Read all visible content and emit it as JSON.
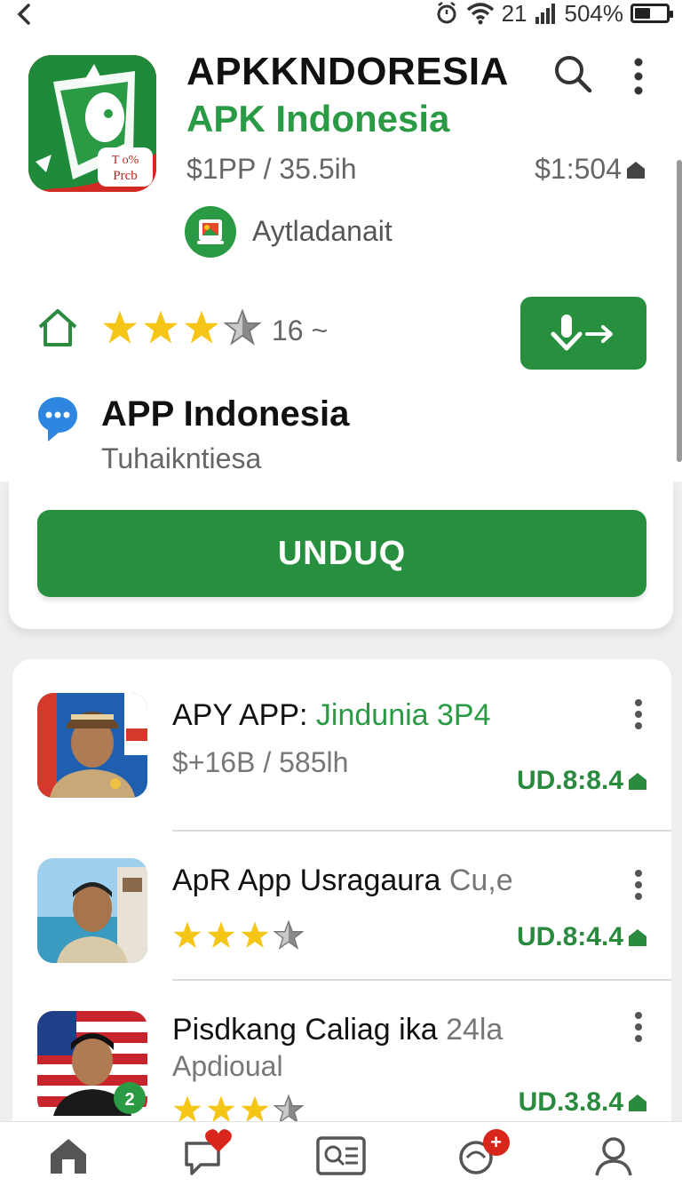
{
  "status_bar": {
    "signal_text": "21",
    "battery_text": "504%",
    "battery_level": 0.5
  },
  "app": {
    "title": "APKKNDORESIA",
    "subtitle": "APK Indonesia",
    "meta_left": "$1PP / 35.5ih",
    "meta_right": "$1:504",
    "developer": "Aytladanait",
    "icon_text_line1": "T o%",
    "icon_text_line2": "Prcb",
    "rating_stars": 3.5,
    "rating_count": "16 ~",
    "section_title": "APP Indonesia",
    "section_subtitle": "Tuhaikntiesa",
    "download_label": "UNDUQ"
  },
  "list": {
    "items": [
      {
        "title_main": "APY APP: ",
        "title_accent": "Jindunia 3P4",
        "subtitle": "$+16B / 585lh",
        "price": "UD.8:8.4",
        "stars": null
      },
      {
        "title_main": "ApR App Usragaura ",
        "title_muted": "Cu,e",
        "subtitle": "",
        "price": "UD.8:4.4",
        "stars": 3.5
      },
      {
        "title_main": "Pisdkang Caliag ika ",
        "title_muted": "24la",
        "subtitle": "Apdioual",
        "price": "UD.3.8.4",
        "stars": 3.5
      }
    ]
  },
  "colors": {
    "brand_green": "#27903e",
    "accent_green": "#2a9a44",
    "star_gold": "#f5c518",
    "badge_red": "#d9261c"
  },
  "icons": {
    "back": "back-arrow-icon",
    "search": "search-icon",
    "more": "more-vertical-icon",
    "home": "home-icon",
    "chat": "chat-bubble-icon",
    "install": "download-arrow-icon",
    "nav": [
      "home-icon",
      "messages-icon",
      "id-card-icon",
      "notifications-icon",
      "profile-icon"
    ]
  }
}
